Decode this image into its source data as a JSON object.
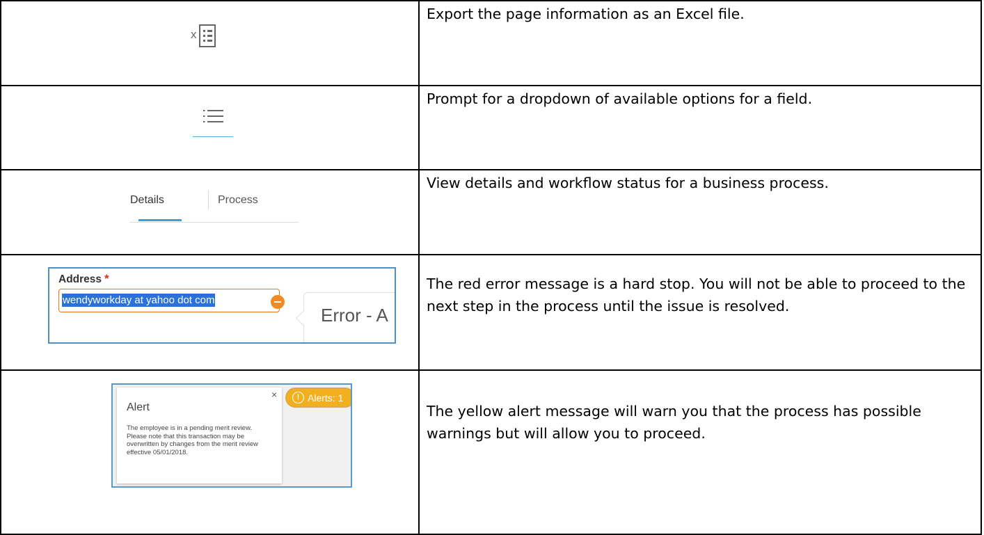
{
  "rows": [
    {
      "icon": "excel-export-icon",
      "description": "Export the page information as an Excel file."
    },
    {
      "icon": "list-prompt-icon",
      "description": "Prompt for a dropdown of available options for a field."
    },
    {
      "icon": "details-process-tabs",
      "description": "View details and workflow status for a business process."
    },
    {
      "icon": "address-error-field",
      "description": "The red error message is a hard stop. You will not be able to proceed to the next step in the process until the issue is resolved."
    },
    {
      "icon": "alert-popup",
      "description": "The yellow alert message will warn you that the process has possible warnings but will allow you to proceed."
    }
  ],
  "excel_icon": {
    "glyph": "x"
  },
  "tabs": {
    "details": "Details",
    "process": "Process",
    "accent": "#3f9fd6"
  },
  "address_field": {
    "label": "Address",
    "required_mark": "*",
    "value": "wendyworkday at yahoo dot com",
    "error_text": "Error - A",
    "error_color": "#e8761f"
  },
  "alert": {
    "close": "×",
    "title": "Alert",
    "body": "The employee is in a pending merit review. Please note that this transaction may be overwritten by changes from the merit review effective 05/01/2018.",
    "badge_icon": "!",
    "badge_text": "Alerts: 1",
    "badge_color": "#f2b01e"
  }
}
